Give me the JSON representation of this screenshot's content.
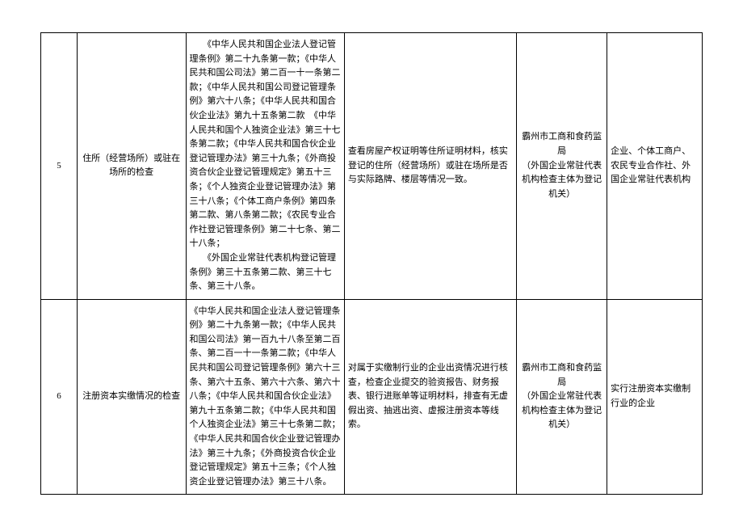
{
  "rows": [
    {
      "num": "5",
      "item": "住所（经营场所）或驻在场所的检查",
      "basis": "　　《中华人民共和国企业法人登记管理条例》第二十九条第一款；《中华人民共和国公司法》第二百一十一条第二款；《中华人民共和国公司登记管理条例》第六十八条；《中华人民共和国合伙企业法》第九十五条第二款　《中华人民共和国个人独资企业法》第三十七条第二款；《中华人民共和国合伙企业登记管理办法》第三十九条；《外商投资合伙企业登记管理规定》第五十三条；《个人独资企业登记管理办法》第三十八条；《个体工商户条例》第四条第二款、第八条第二款；《农民专业合作社登记管理条例》第二十七条、第二十八条；\n　　《外国企业常驻代表机构登记管理条例》第三十五条第二款、第三十七条、第三十八条。",
      "content": "查看房屋产权证明等住所证明材料，核实登记的住所（经营场所）或驻在场所是否与实际路牌、楼层等情况一致。",
      "dept": "霸州市工商和食药监局\n（外国企业常驻代表机构检查主体为登记\n机关）",
      "obj": "企业、个体工商户、农民专业合作社、外国企业常驻代表机构"
    },
    {
      "num": "6",
      "item": "注册资本实缴情况的检查",
      "basis": "《中华人民共和国企业法人登记管理条例》第二十九条第一款；《中华人民共和国公司法》第一百九十八条至第二百条、第二百一十一条第二款；《中华人民共和国公司登记管理条例》第六十三条、第六十五条、第六十六条、第六十八条；《中华人民共和国合伙企业法》第九十五条第二款；《中华人民共和国个人独资企业法》第三十七条第二款；《中华人民共和国合伙企业登记管理办法》第三十九条；《外商投资合伙企业登记管理规定》第五十三条；《个人独资企业登记管理办法》第三十八条。",
      "content": "对属于实缴制行业的企业出资情况进行核查，检查企业提交的验资报告、财务报表、银行进账单等证明材料，排查有无虚假出资、抽逃出资、虚报注册资本等线索。",
      "dept": "霸州市工商和食药监局\n（外国企业常驻代表机构检查主体为登记\n机关）",
      "obj": "实行注册资本实缴制行业的企业"
    }
  ]
}
